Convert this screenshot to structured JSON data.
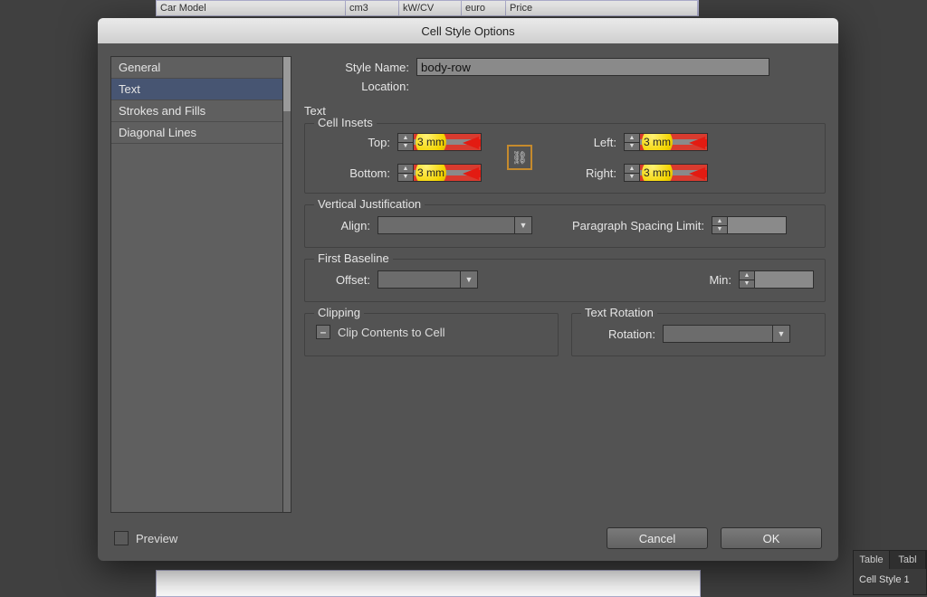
{
  "bg_table": {
    "cols": [
      "Car Model",
      "cm3",
      "kW/CV",
      "euro",
      "Price"
    ]
  },
  "dialog": {
    "title": "Cell Style Options",
    "sidebar": {
      "items": [
        "General",
        "Text",
        "Strokes and Fills",
        "Diagonal Lines"
      ],
      "selected": 1
    },
    "style_name_label": "Style Name:",
    "style_name_value": "body-row",
    "location_label": "Location:",
    "section_title": "Text",
    "cell_insets": {
      "legend": "Cell Insets",
      "top_label": "Top:",
      "top_value": "3 mm",
      "bottom_label": "Bottom:",
      "bottom_value": "3 mm",
      "left_label": "Left:",
      "left_value": "3 mm",
      "right_label": "Right:",
      "right_value": "3 mm"
    },
    "vjust": {
      "legend": "Vertical Justification",
      "align_label": "Align:",
      "psl_label": "Paragraph Spacing Limit:"
    },
    "baseline": {
      "legend": "First Baseline",
      "offset_label": "Offset:",
      "min_label": "Min:"
    },
    "clipping": {
      "legend": "Clipping",
      "label": "Clip Contents to Cell"
    },
    "rotation": {
      "legend": "Text Rotation",
      "label": "Rotation:"
    },
    "preview_label": "Preview",
    "cancel_label": "Cancel",
    "ok_label": "OK"
  },
  "panel": {
    "tabs": [
      "Table",
      "Tabl"
    ],
    "item": "Cell Style 1"
  }
}
